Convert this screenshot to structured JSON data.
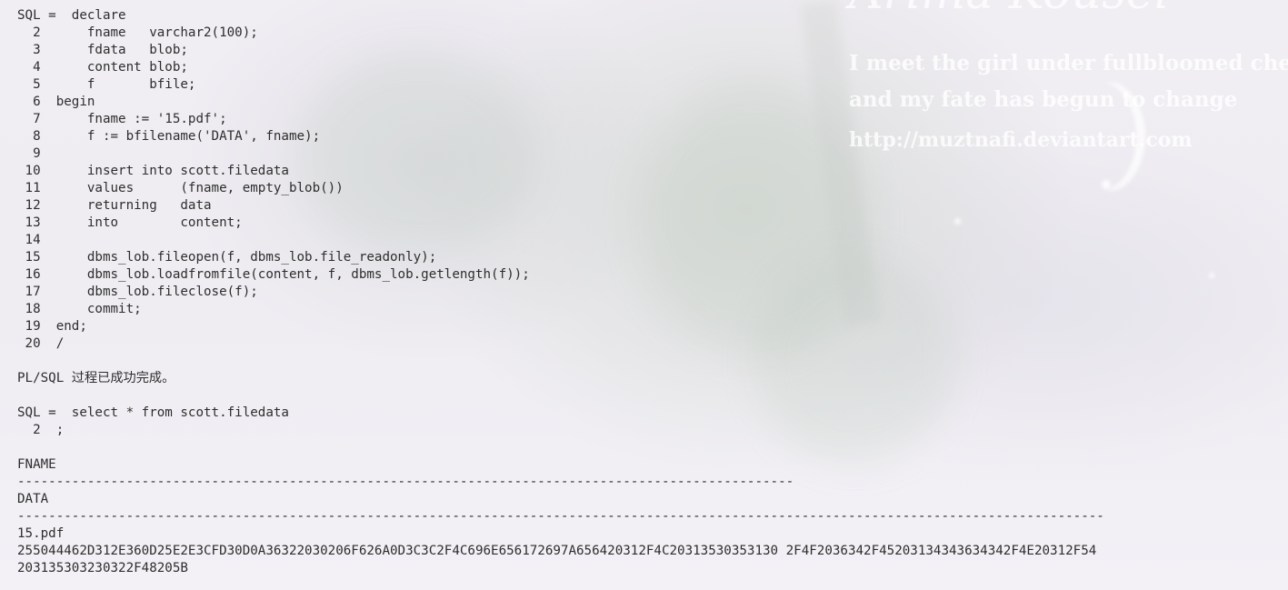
{
  "wallpaper": {
    "title": "Arima Kousei",
    "line1": "I meet the girl under fullbloomed cheery blossom",
    "line2": "and my fate has begun to change",
    "line3": "http://muztnafi.deviantart.com"
  },
  "terminal": {
    "lines": [
      "SQL =  declare",
      "  2      fname   varchar2(100);",
      "  3      fdata   blob;",
      "  4      content blob;",
      "  5      f       bfile;",
      "  6  begin",
      "  7      fname := '15.pdf';",
      "  8      f := bfilename('DATA', fname);",
      "  9",
      " 10      insert into scott.filedata",
      " 11      values      (fname, empty_blob())",
      " 12      returning   data",
      " 13      into        content;",
      " 14",
      " 15      dbms_lob.fileopen(f, dbms_lob.file_readonly);",
      " 16      dbms_lob.loadfromfile(content, f, dbms_lob.getlength(f));",
      " 17      dbms_lob.fileclose(f);",
      " 18      commit;",
      " 19  end;",
      " 20  /",
      "",
      "PL/SQL 过程已成功完成。",
      "",
      "SQL =  select * from scott.filedata",
      "  2  ;",
      "",
      "FNAME",
      "----------------------------------------------------------------------------------------------------",
      "DATA",
      "--------------------------------------------------------------------------------------------------------------------------------------------",
      "15.pdf",
      "255044462D312E360D25E2E3CFD30D0A36322030206F626A0D3C3C2F4C696E656172697A656420312F4C20313530353130 2F4F2036342F45203134343634342F4E20312F54",
      "203135303230322F48205B"
    ]
  }
}
